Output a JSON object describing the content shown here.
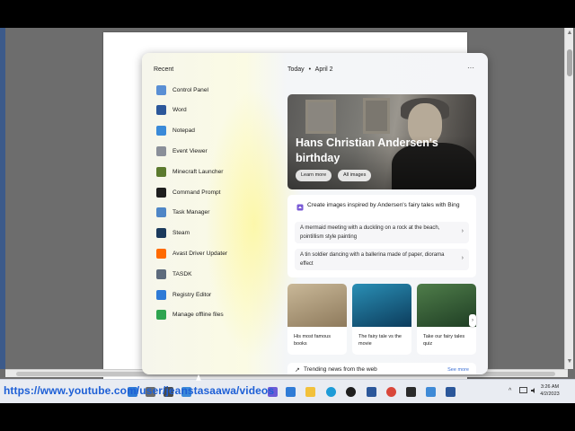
{
  "widgets": {
    "recent_label": "Recent",
    "recent_items": [
      {
        "label": "Control Panel",
        "icon": "control-panel-icon",
        "color": "#5a8fd4"
      },
      {
        "label": "Word",
        "icon": "word-icon",
        "color": "#2b579a"
      },
      {
        "label": "Notepad",
        "icon": "notepad-icon",
        "color": "#3a8ad8"
      },
      {
        "label": "Event Viewer",
        "icon": "event-viewer-icon",
        "color": "#8a8f99"
      },
      {
        "label": "Minecraft Launcher",
        "icon": "minecraft-icon",
        "color": "#5b7a2e"
      },
      {
        "label": "Command Prompt",
        "icon": "terminal-icon",
        "color": "#1e1e1e"
      },
      {
        "label": "Task Manager",
        "icon": "task-manager-icon",
        "color": "#4f86c6"
      },
      {
        "label": "Steam",
        "icon": "steam-icon",
        "color": "#1b3a5c"
      },
      {
        "label": "Avast Driver Updater",
        "icon": "avast-icon",
        "color": "#ff6a00"
      },
      {
        "label": "TASDK",
        "icon": "search-icon",
        "color": "#5d6b7c"
      },
      {
        "label": "Registry Editor",
        "icon": "registry-icon",
        "color": "#2f7bd6"
      },
      {
        "label": "Manage offline files",
        "icon": "sync-icon",
        "color": "#2ea44f"
      }
    ],
    "date_today": "Today",
    "date_sep": "•",
    "date_value": "April 2",
    "more_label": "···",
    "hero": {
      "title": "Hans Christian Andersen's birthday",
      "learn_more": "Learn more",
      "all_images": "All images"
    },
    "bing": {
      "title": "Create images inspired by Andersen's fairy tales with Bing",
      "prompts": [
        "A mermaid meeting with a duckling on a rock at the beach, pointillism style painting",
        "A tin soldier dancing with a ballerina made of paper, diorama effect"
      ],
      "chevron": "›"
    },
    "stories": [
      {
        "label": "His most famous books",
        "colors": [
          "#c9b898",
          "#8e7a5c"
        ]
      },
      {
        "label": "The fairy tale vs the movie",
        "colors": [
          "#2a8fb5",
          "#0c3c5c"
        ]
      },
      {
        "label": "Take our fairy tales quiz",
        "colors": [
          "#4f7d4a",
          "#1f3e24"
        ]
      }
    ],
    "story_nav": "›",
    "trending": {
      "label": "Trending news from the web",
      "see_more": "See more",
      "icon": "↗"
    }
  },
  "taskbar": {
    "url_overlay": "https://www.youtube.com/user/jeanstasaawa/videos",
    "time": "3:26 AM",
    "date": "4/2/2023",
    "tray_chevron": "^",
    "icons": [
      {
        "name": "start-icon",
        "color": "#2f7bd6"
      },
      {
        "name": "search-icon",
        "color": "#6b6b6b"
      },
      {
        "name": "task-view-icon",
        "color": "#4a4a4a"
      },
      {
        "name": "widgets-icon",
        "color": "#3b8ad8"
      },
      {
        "name": "chat-icon",
        "color": "#6b5bd6"
      },
      {
        "name": "store-icon",
        "color": "#2f7bd6"
      },
      {
        "name": "file-explorer-icon",
        "color": "#f2c13b"
      },
      {
        "name": "edge-icon",
        "color": "#1d9bd7"
      },
      {
        "name": "media-player-icon",
        "color": "#1e1e1e"
      },
      {
        "name": "word-icon",
        "color": "#2b579a"
      },
      {
        "name": "chrome-icon",
        "color": "#d9473a"
      },
      {
        "name": "terminal-icon",
        "color": "#2b2b2b"
      },
      {
        "name": "photos-icon",
        "color": "#3f8ad6"
      },
      {
        "name": "word-doc-icon",
        "color": "#2b579a"
      }
    ]
  }
}
